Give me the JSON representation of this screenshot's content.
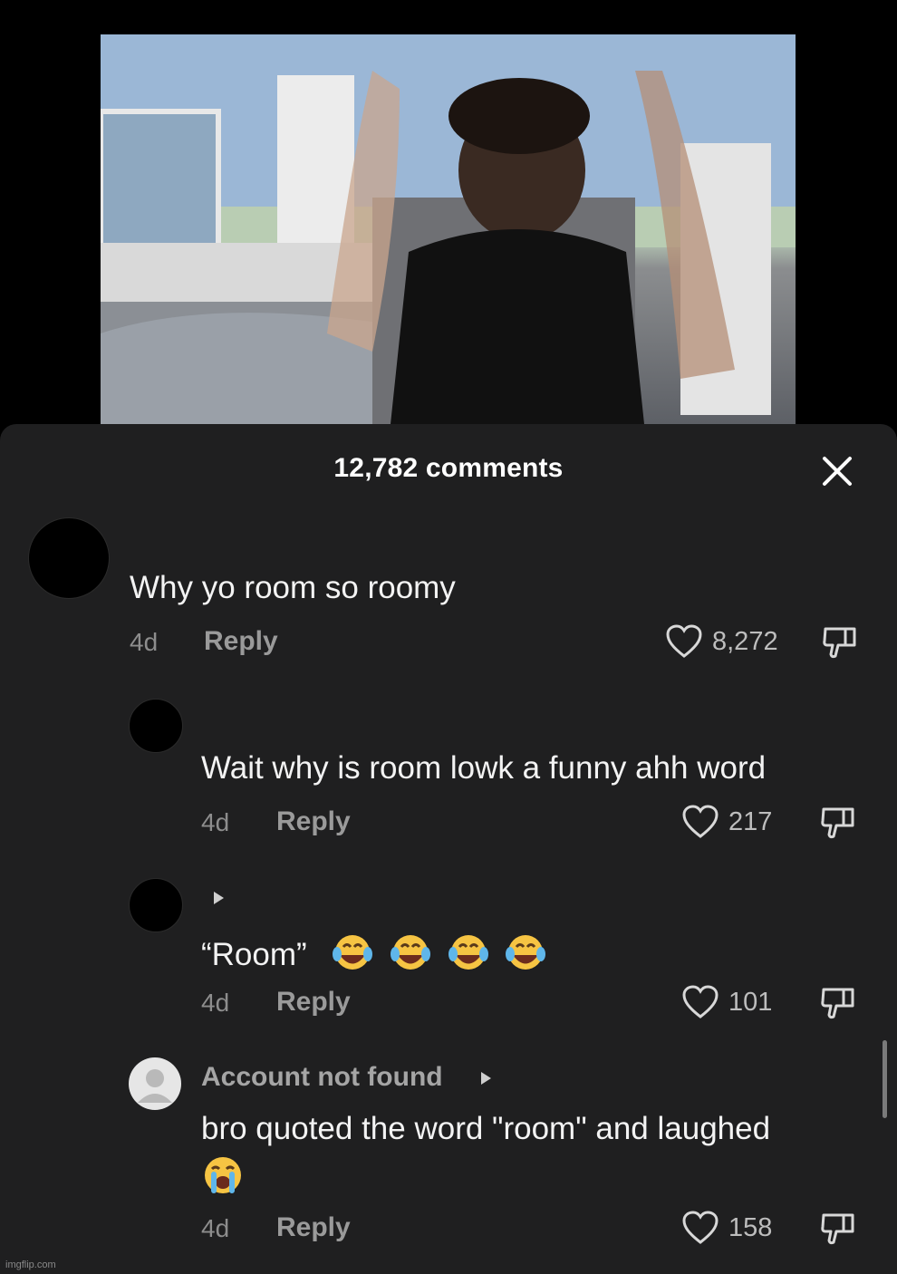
{
  "header": {
    "title": "12,782 comments"
  },
  "comments": [
    {
      "text": "Why yo room so roomy",
      "time": "4d",
      "reply": "Reply",
      "likes": "8,272"
    },
    {
      "text": "Wait why is room lowk a funny ahh word",
      "time": "4d",
      "reply": "Reply",
      "likes": "217"
    },
    {
      "text": "“Room”",
      "time": "4d",
      "reply": "Reply",
      "likes": "101"
    },
    {
      "username": "Account not found",
      "text": "bro quoted the word \"room\" and laughed",
      "time": "4d",
      "reply": "Reply",
      "likes": "158"
    }
  ],
  "watermark": "imgflip.com",
  "colors": {
    "sheet": "#1f1f20",
    "background": "#000000",
    "secondary_text": "#8d8d8d"
  }
}
